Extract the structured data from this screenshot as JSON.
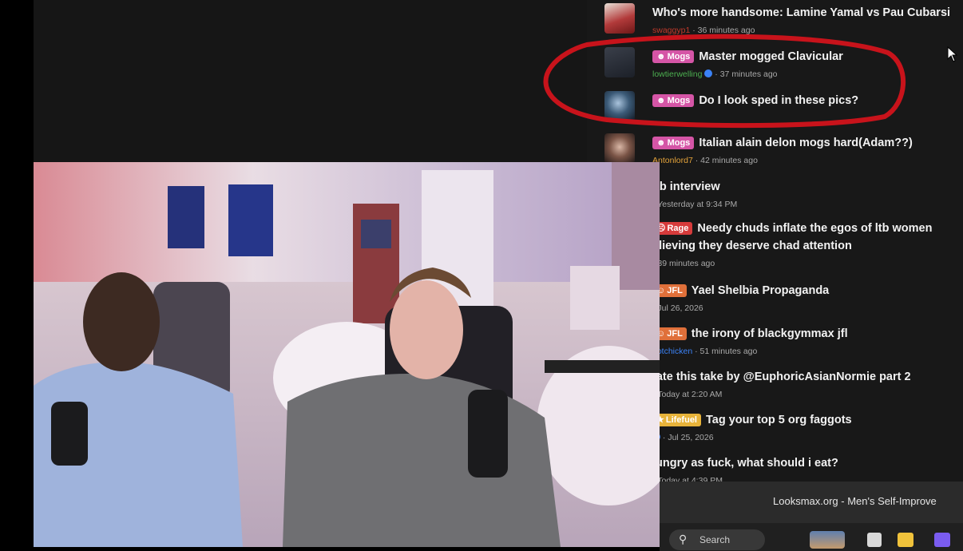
{
  "forum": {
    "threads": [
      {
        "title": "Who's more handsome: Lamine Yamal vs Pau Cubarsi",
        "user": "swaggyp1",
        "time": "36 minutes ago",
        "prefix": "",
        "prefix_icon": "",
        "user_color": "#c0392b",
        "verified": false
      },
      {
        "title": "Master mogged Clavicular",
        "user": "lowtierwelling",
        "time": "37 minutes ago",
        "prefix": "Mogs",
        "prefix_icon": "☻",
        "user_color": "#4caf50",
        "verified": true
      },
      {
        "title": "Do I look sped in these pics?",
        "user": "",
        "time": "",
        "prefix": "Mogs",
        "prefix_icon": "☻",
        "user_color": "#8e8e8e",
        "verified": false
      },
      {
        "title": "Italian alain delon mogs hard(Adam??)",
        "user": "Antonlord7",
        "time": "42 minutes ago",
        "prefix": "Mogs",
        "prefix_icon": "☻",
        "user_color": "#e4a33a",
        "verified": false
      },
      {
        "title": "ob interview",
        "user": "",
        "time": "Yesterday at 9:34 PM",
        "prefix": "",
        "prefix_icon": "",
        "user_color": "#4caf50",
        "verified": false
      },
      {
        "title": "Needy chuds inflate the egos of ltb women",
        "title2": "elieving they deserve chad attention",
        "user": "",
        "time": "39 minutes ago",
        "prefix": "Rage",
        "prefix_icon": "☹",
        "user_color": "#8e8e8e",
        "verified": false
      },
      {
        "title": "Yael Shelbia Propaganda",
        "user": "",
        "time": "Jul 26, 2026",
        "prefix": "JFL",
        "prefix_icon": "☺",
        "user_color": "#3b82f6",
        "verified": false
      },
      {
        "title": "the irony of blackgymmax jfl",
        "user": "botchicken",
        "time": "51 minutes ago",
        "prefix": "JFL",
        "prefix_icon": "☺",
        "user_color": "#3b82f6",
        "verified": false
      },
      {
        "title": "tate this take by @EuphoricAsianNormie part 2",
        "user": "",
        "time": "Today at 2:20 AM",
        "prefix": "",
        "prefix_icon": "",
        "user_color": "#8e8e8e",
        "verified": false
      },
      {
        "title": "Tag your top 5 org faggots",
        "user": "",
        "time": "Jul 25, 2026",
        "prefix": "Lifefuel",
        "prefix_icon": "★",
        "user_color": "#e04b4b",
        "verified": true
      },
      {
        "title": "lungry as fuck, what should i eat?",
        "user": "",
        "time": "Today at 4:39 PM",
        "prefix": "",
        "prefix_icon": "",
        "user_color": "#8e8e8e",
        "verified": false
      }
    ]
  },
  "browser": {
    "tab_title": "Looksmax.org - Men's Self-Improve"
  },
  "taskbar": {
    "search_label": "Search",
    "search_icon": "search-icon"
  },
  "colors": {
    "annotation": "#c8131b",
    "background": "#181818",
    "mogs": "#d555a6",
    "rage": "#d63b3b",
    "jfl": "#e0703a",
    "lifefuel": "#e7b33a"
  }
}
